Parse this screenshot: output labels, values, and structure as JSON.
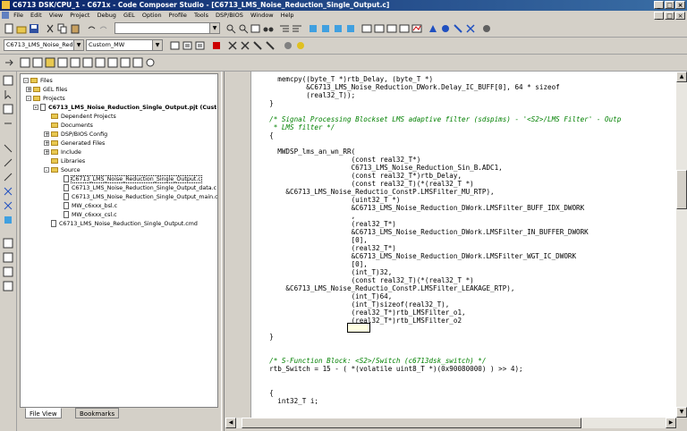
{
  "window": {
    "title": "C6713 DSK/CPU_1 - C671x - Code Composer Studio - [C6713_LMS_Noise_Reduction_Single_Output.c]"
  },
  "menu": [
    "File",
    "Edit",
    "View",
    "Project",
    "Debug",
    "GEL",
    "Option",
    "Profile",
    "Tools",
    "DSP/BIOS",
    "Window",
    "Help"
  ],
  "toolbar": {
    "search_value": "",
    "project_combo": "C6713_LMS_Noise_Redu",
    "config_combo": "Custom_MW"
  },
  "tree": [
    {
      "label": "Files",
      "expander": "-",
      "icon": "folder"
    },
    {
      "label": "GEL files",
      "expander": "+",
      "icon": "folder"
    },
    {
      "label": "Projects",
      "expander": "-",
      "icon": "folder"
    },
    {
      "label": "C6713_LMS_Noise_Reduction_Single_Output.pjt (Cust",
      "expander": "-",
      "icon": "file"
    },
    {
      "label": "Dependent Projects",
      "expander": "",
      "icon": "folder"
    },
    {
      "label": "Documents",
      "expander": "",
      "icon": "folder"
    },
    {
      "label": "DSP/BIOS Config",
      "expander": "+",
      "icon": "folder"
    },
    {
      "label": "Generated Files",
      "expander": "+",
      "icon": "folder"
    },
    {
      "label": "Include",
      "expander": "+",
      "icon": "folder"
    },
    {
      "label": "Libraries",
      "expander": "",
      "icon": "folder"
    },
    {
      "label": "Source",
      "expander": "-",
      "icon": "folder"
    },
    {
      "label": "C6713_LMS_Noise_Reduction_Single_Output.c",
      "expander": "",
      "icon": "file"
    },
    {
      "label": "C6713_LMS_Noise_Reduction_Single_Output_data.c",
      "expander": "",
      "icon": "file"
    },
    {
      "label": "C6713_LMS_Noise_Reduction_Single_Output_main.c",
      "expander": "",
      "icon": "file"
    },
    {
      "label": "MW_c6xxx_bsl.c",
      "expander": "",
      "icon": "file"
    },
    {
      "label": "MW_c6xxx_csl.c",
      "expander": "",
      "icon": "file"
    },
    {
      "label": "C6713_LMS_Noise_Reduction_Single_Output.cmd",
      "expander": "",
      "icon": "file"
    }
  ],
  "tabs": {
    "file_view": "File View",
    "bookmarks": "Bookmarks"
  },
  "code_lines": [
    "    memcpy((byte_T *)rtb_Delay, (byte_T *)",
    "           &C6713_LMS_Noise_Reduction_DWork.Delay_IC_BUFF[0], 64 * sizeof",
    "           (real32_T));",
    "  }",
    "",
    "  /* Signal Processing Blockset LMS adaptive filter (sdspims) - '<S2>/LMS Filter' - Outp",
    "   * LMS filter */",
    "  {",
    "    MWDSP_lms_an_wn_RR(",
    "                      (const real32_T*)",
    "                      C6713_LMS_Noise_Reduction_Sin_B.ADC1,",
    "                      (const real32_T*)rtb_Delay,",
    "                      (const real32_T)(*(real32_T *)",
    "      &C6713_LMS_Noise_Reductio_ConstP.LMSFilter_MU_RTP),",
    "                      (uint32_T *)",
    "                      &C6713_LMS_Noise_Reduction_DWork.LMSFilter_BUFF_IDX_DWORK",
    "                      ,",
    "                      (real32_T*)",
    "                      &C6713_LMS_Noise_Reduction_DWork.LMSFilter_IN_BUFFER_DWORK",
    "                      [0],",
    "                      (real32_T*)",
    "                      &C6713_LMS_Noise_Reduction_DWork.LMSFilter_WGT_IC_DWORK",
    "                      [0],",
    "                      (int_T)32,",
    "                      (const real32_T)(*(real32_T *)",
    "      &C6713_LMS_Noise_Reductio_ConstP.LMSFilter_LEAKAGE_RTP),",
    "                      (int_T)64,",
    "                      (int_T)sizeof(real32_T),",
    "                      (real32_T*)rtb_LMSFilter_o1,",
    "                      (real32_T*)rtb_LMSFilter_o2",
    "                      );",
    "  }",
    "",
    "  /* S-Function Block: <S2>/Switch (c6713dsk_switch) */",
    "  rtb_Switch = 15 - ( *(volatile uint8_T *)(0x90080000) ) >> 4);",
    "",
    "  {",
    "    int32_T i;"
  ]
}
